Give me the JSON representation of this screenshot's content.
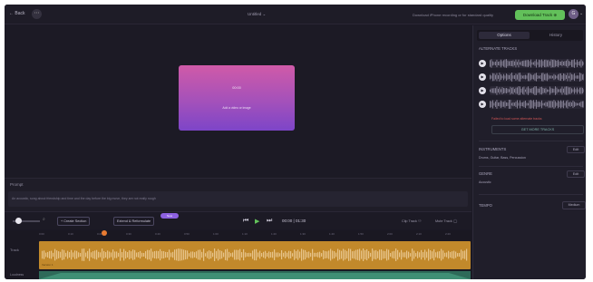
{
  "topbar": {
    "back_label": "← Back",
    "title": "Untitled ⌄",
    "notice": "Download iPhone recording or for standard quality",
    "download_label": "Download Track ⊕",
    "avatar_initial": "G"
  },
  "preview": {
    "card_title": "00:00",
    "card_subtitle": "Add a video or image"
  },
  "prompt": {
    "label": "Prompt",
    "text": "An acoustic, song about friendship and time and the day before the big move, they are not really rough"
  },
  "controls": {
    "create_section_label": "+ Create Section",
    "extend_label": "Extend & Reformulate",
    "new_badge": "New",
    "time_current": "00:00",
    "time_total": "01:30",
    "clip_track_label": "Clip Track",
    "mute_track_label": "Mute Track"
  },
  "timeline": {
    "ticks": [
      "0:00",
      "0:10",
      "0:20",
      "0:30",
      "0:40",
      "0:50",
      "1:00",
      "1:10",
      "1:20",
      "1:30",
      "1:40",
      "1:50",
      "2:00",
      "2:10",
      "2:20"
    ],
    "track_label": "Track",
    "track_name": "Version 1",
    "lane_label": "Loudness"
  },
  "sidebar": {
    "tabs": [
      "Options",
      "History"
    ],
    "alternate_title": "ALTERNATE TRACKS",
    "warning": "Failed to load some alternate tracks",
    "more_label": "GET MORE TRACKS",
    "instruments_title": "INSTRUMENTS",
    "instruments_value": "Drums, Guitar, Bass, Percussion",
    "genre_title": "GENRE",
    "genre_value": "Acoustic",
    "tempo_title": "TEMPO",
    "tempo_value": "Medium",
    "edit_label": "Edit"
  },
  "colors": {
    "accent_green": "#62c05a",
    "track_orange": "#c2892b",
    "card_gradient_top": "#d05aa8",
    "card_gradient_bottom": "#7d45c8"
  }
}
